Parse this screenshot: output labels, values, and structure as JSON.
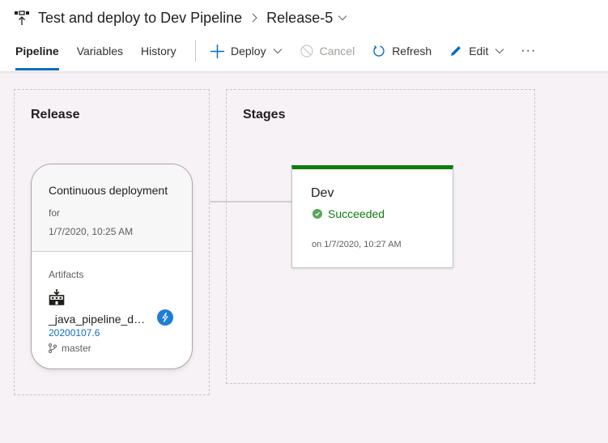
{
  "header": {
    "title": "Test and deploy to Dev Pipeline",
    "release": "Release-5",
    "icons": {
      "title": "release-pipeline-icon",
      "separator": "chevron-right-icon",
      "release_dropdown": "chevron-down-icon"
    }
  },
  "tabs": [
    {
      "label": "Pipeline",
      "active": true
    },
    {
      "label": "Variables",
      "active": false
    },
    {
      "label": "History",
      "active": false
    }
  ],
  "toolbar": {
    "deploy": {
      "label": "Deploy",
      "icon": "plus-icon"
    },
    "cancel": {
      "label": "Cancel",
      "icon": "cancel-icon",
      "disabled": true
    },
    "refresh": {
      "label": "Refresh",
      "icon": "refresh-icon"
    },
    "edit": {
      "label": "Edit",
      "icon": "pencil-icon"
    },
    "more": "···"
  },
  "release_group": {
    "title": "Release",
    "trigger": {
      "title": "Continuous deployment",
      "for_label": "for",
      "date": "1/7/2020, 10:25 AM"
    },
    "artifacts": {
      "label": "Artifacts",
      "name": "_java_pipeline_d…",
      "version": "20200107.6",
      "branch": "master",
      "icons": {
        "artifact": "build-artifact-icon",
        "trigger": "lightning-icon",
        "branch": "branch-icon"
      }
    }
  },
  "stages_group": {
    "title": "Stages",
    "stages": [
      {
        "name": "Dev",
        "status": "Succeeded",
        "date": "on 1/7/2020, 10:27 AM",
        "status_color": "#107c10"
      }
    ]
  },
  "colors": {
    "accent": "#0f6cbd",
    "success": "#107c10",
    "canvas": "#f6f2f6"
  }
}
